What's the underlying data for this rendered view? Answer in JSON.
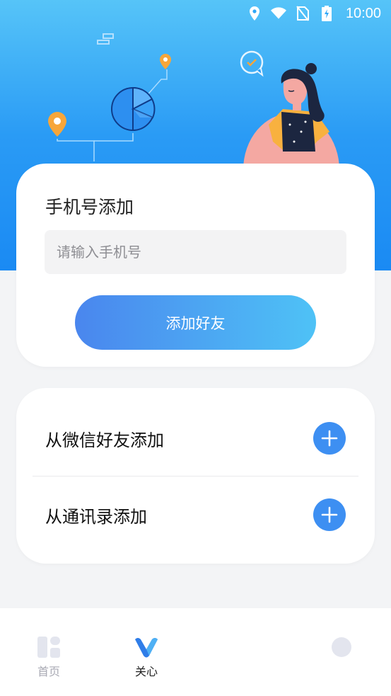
{
  "status_bar": {
    "time": "10:00"
  },
  "phone_card": {
    "title": "手机号添加",
    "input_value": "",
    "input_placeholder": "请输入手机号",
    "submit_label": "添加好友"
  },
  "options": [
    {
      "label": "从微信好友添加",
      "icon": "plus-icon"
    },
    {
      "label": "从通讯录添加",
      "icon": "plus-icon"
    }
  ],
  "tabbar": {
    "items": [
      {
        "label": "首页",
        "icon": "home-grid-icon",
        "active": false
      },
      {
        "label": "关心",
        "icon": "v-logo-icon",
        "active": true
      },
      {
        "label": "",
        "icon": "profile-icon",
        "active": false
      }
    ]
  },
  "colors": {
    "header_gradient_top": "#56c4f8",
    "header_gradient_bottom": "#1a8af3",
    "button_gradient_start": "#4a86ee",
    "button_gradient_end": "#4ec2f6",
    "plus_button": "#3d8ff2",
    "tab_active": "#222222",
    "tab_inactive": "#a9aab4"
  }
}
